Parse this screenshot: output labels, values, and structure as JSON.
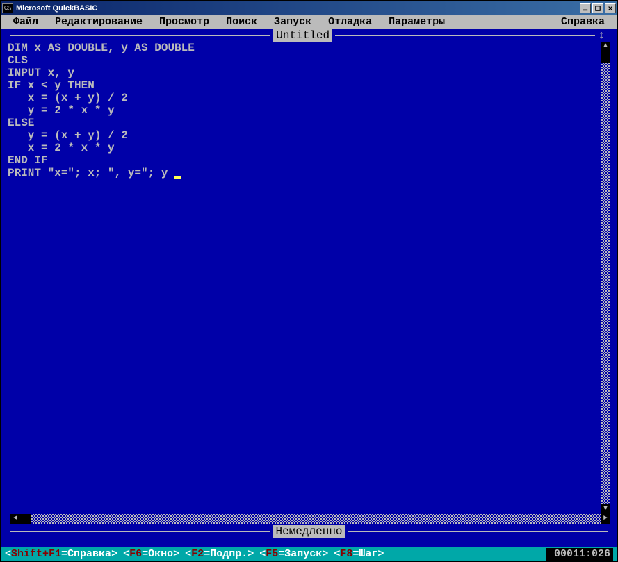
{
  "titlebar": {
    "icon_text": "C:\\",
    "title": "Microsoft QuickBASIC"
  },
  "menu": {
    "items": [
      "Файл",
      "Редактирование",
      "Просмотр",
      "Поиск",
      "Запуск",
      "Отладка",
      "Параметры"
    ],
    "help": "Справка"
  },
  "editor": {
    "file_tab": "Untitled",
    "code": "DIM x AS DOUBLE, y AS DOUBLE\nCLS\nINPUT x, y\nIF x < y THEN\n   x = (x + y) / 2\n   y = 2 * x * y\nELSE\n   y = (x + y) / 2\n   x = 2 * x * y\nEND IF\nPRINT \"x=\"; x; \", y=\"; y ",
    "top_arrows": "↑"
  },
  "immediate": {
    "label": "Немедленно"
  },
  "status": {
    "hints": [
      {
        "key": "Shift+F1",
        "label": "Справка"
      },
      {
        "key": "F6",
        "label": "Окно"
      },
      {
        "key": "F2",
        "label": "Подпр."
      },
      {
        "key": "F5",
        "label": "Запуск"
      },
      {
        "key": "F8",
        "label": "Шаг"
      }
    ],
    "position": "00011:026"
  }
}
